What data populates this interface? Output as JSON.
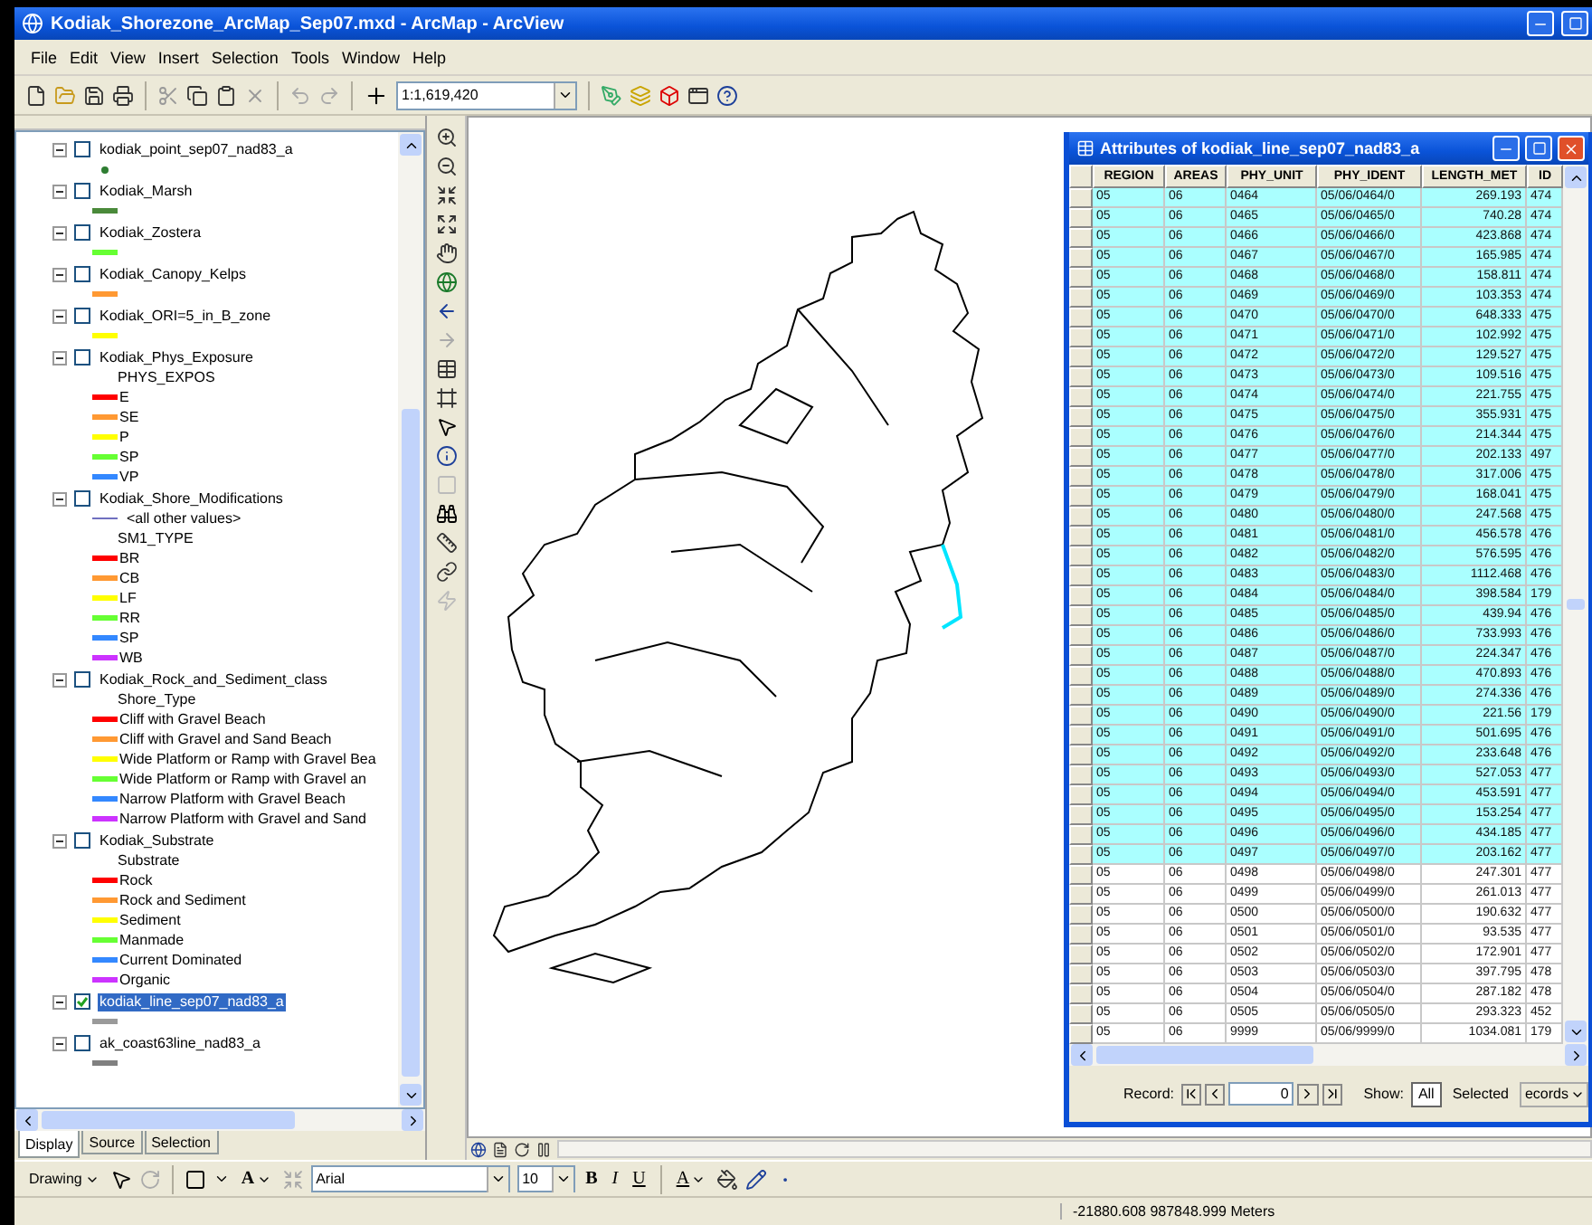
{
  "window": {
    "title": "Kodiak_Shorezone_ArcMap_Sep07.mxd - ArcMap - ArcView"
  },
  "menu": [
    {
      "label": "File"
    },
    {
      "label": "Edit"
    },
    {
      "label": "View"
    },
    {
      "label": "Insert"
    },
    {
      "label": "Selection"
    },
    {
      "label": "Tools"
    },
    {
      "label": "Window"
    },
    {
      "label": "Help"
    }
  ],
  "standard_toolbar": {
    "scale": "1:1,619,420"
  },
  "toc": {
    "layers": [
      {
        "name": "kodiak_point_sep07_nad83_a",
        "checked": false,
        "selected": false,
        "legend": [
          {
            "kind": "point",
            "color": "#2e7d32"
          }
        ]
      },
      {
        "name": "Kodiak_Marsh",
        "checked": false,
        "selected": false,
        "legend": [
          {
            "kind": "line",
            "color": "#4a8a3a"
          }
        ]
      },
      {
        "name": "Kodiak_Zostera",
        "checked": false,
        "selected": false,
        "legend": [
          {
            "kind": "line",
            "color": "#66ff33"
          }
        ]
      },
      {
        "name": "Kodiak_Canopy_Kelps",
        "checked": false,
        "selected": false,
        "legend": [
          {
            "kind": "line",
            "color": "#ff9933"
          }
        ]
      },
      {
        "name": "Kodiak_ORI=5_in_B_zone",
        "checked": false,
        "selected": false,
        "legend": [
          {
            "kind": "line",
            "color": "#ffff00"
          }
        ]
      },
      {
        "name": "Kodiak_Phys_Exposure",
        "checked": false,
        "selected": false,
        "legend": [
          {
            "kind": "heading",
            "label": "PHYS_EXPOS"
          },
          {
            "kind": "line",
            "color": "#ff0000",
            "label": "E"
          },
          {
            "kind": "line",
            "color": "#ff9933",
            "label": "SE"
          },
          {
            "kind": "line",
            "color": "#ffff00",
            "label": "P"
          },
          {
            "kind": "line",
            "color": "#66ff33",
            "label": "SP"
          },
          {
            "kind": "line",
            "color": "#3388ff",
            "label": "VP"
          }
        ]
      },
      {
        "name": "Kodiak_Shore_Modifications",
        "checked": false,
        "selected": false,
        "legend": [
          {
            "kind": "thin",
            "color": "#7070c0",
            "label": "<all other values>"
          },
          {
            "kind": "heading",
            "label": "SM1_TYPE"
          },
          {
            "kind": "line",
            "color": "#ff0000",
            "label": "BR"
          },
          {
            "kind": "line",
            "color": "#ff9933",
            "label": "CB"
          },
          {
            "kind": "line",
            "color": "#ffff00",
            "label": "LF"
          },
          {
            "kind": "line",
            "color": "#66ff33",
            "label": "RR"
          },
          {
            "kind": "line",
            "color": "#3388ff",
            "label": "SP"
          },
          {
            "kind": "line",
            "color": "#cc33ff",
            "label": "WB"
          }
        ]
      },
      {
        "name": "Kodiak_Rock_and_Sediment_class",
        "checked": false,
        "selected": false,
        "legend": [
          {
            "kind": "heading",
            "label": "Shore_Type"
          },
          {
            "kind": "line",
            "color": "#ff0000",
            "label": "Cliff with Gravel Beach"
          },
          {
            "kind": "line",
            "color": "#ff9933",
            "label": "Cliff with Gravel and Sand Beach"
          },
          {
            "kind": "line",
            "color": "#ffff00",
            "label": "Wide Platform or Ramp with Gravel Bea"
          },
          {
            "kind": "line",
            "color": "#66ff33",
            "label": "Wide Platform or Ramp with Gravel an"
          },
          {
            "kind": "line",
            "color": "#3388ff",
            "label": "Narrow Platform with Gravel Beach"
          },
          {
            "kind": "line",
            "color": "#cc33ff",
            "label": "Narrow Platform with Gravel and Sand"
          }
        ]
      },
      {
        "name": "Kodiak_Substrate",
        "checked": false,
        "selected": false,
        "legend": [
          {
            "kind": "heading",
            "label": "Substrate"
          },
          {
            "kind": "line",
            "color": "#ff0000",
            "label": "Rock"
          },
          {
            "kind": "line",
            "color": "#ff9933",
            "label": "Rock and Sediment"
          },
          {
            "kind": "line",
            "color": "#ffff00",
            "label": "Sediment"
          },
          {
            "kind": "line",
            "color": "#66ff33",
            "label": "Manmade"
          },
          {
            "kind": "line",
            "color": "#3388ff",
            "label": "Current Dominated"
          },
          {
            "kind": "line",
            "color": "#cc33ff",
            "label": "Organic"
          }
        ]
      },
      {
        "name": "kodiak_line_sep07_nad83_a",
        "checked": true,
        "selected": true,
        "legend": [
          {
            "kind": "line",
            "color": "#9a9a9a"
          }
        ]
      },
      {
        "name": "ak_coast63line_nad83_a",
        "checked": false,
        "selected": false,
        "legend": [
          {
            "kind": "line",
            "color": "#808080"
          }
        ]
      }
    ],
    "tabs": [
      {
        "label": "Display",
        "selected": true
      },
      {
        "label": "Source",
        "selected": false
      },
      {
        "label": "Selection",
        "selected": false
      }
    ]
  },
  "attribute_table": {
    "title": "Attributes of kodiak_line_sep07_nad83_a",
    "columns": [
      {
        "label": "REGION"
      },
      {
        "label": "AREAS"
      },
      {
        "label": "PHY_UNIT"
      },
      {
        "label": "PHY_IDENT"
      },
      {
        "label": "LENGTH_MET"
      },
      {
        "label": "ID"
      }
    ],
    "rows": [
      {
        "selected": true,
        "cells": [
          "05",
          "06",
          "0464",
          "05/06/0464/0",
          "269.193",
          "474"
        ]
      },
      {
        "selected": true,
        "cells": [
          "05",
          "06",
          "0465",
          "05/06/0465/0",
          "740.28",
          "474"
        ]
      },
      {
        "selected": true,
        "cells": [
          "05",
          "06",
          "0466",
          "05/06/0466/0",
          "423.868",
          "474"
        ]
      },
      {
        "selected": true,
        "cells": [
          "05",
          "06",
          "0467",
          "05/06/0467/0",
          "165.985",
          "474"
        ]
      },
      {
        "selected": true,
        "cells": [
          "05",
          "06",
          "0468",
          "05/06/0468/0",
          "158.811",
          "474"
        ]
      },
      {
        "selected": true,
        "cells": [
          "05",
          "06",
          "0469",
          "05/06/0469/0",
          "103.353",
          "474"
        ]
      },
      {
        "selected": true,
        "cells": [
          "05",
          "06",
          "0470",
          "05/06/0470/0",
          "648.333",
          "475"
        ]
      },
      {
        "selected": true,
        "cells": [
          "05",
          "06",
          "0471",
          "05/06/0471/0",
          "102.992",
          "475"
        ]
      },
      {
        "selected": true,
        "cells": [
          "05",
          "06",
          "0472",
          "05/06/0472/0",
          "129.527",
          "475"
        ]
      },
      {
        "selected": true,
        "cells": [
          "05",
          "06",
          "0473",
          "05/06/0473/0",
          "109.516",
          "475"
        ]
      },
      {
        "selected": true,
        "cells": [
          "05",
          "06",
          "0474",
          "05/06/0474/0",
          "221.755",
          "475"
        ]
      },
      {
        "selected": true,
        "cells": [
          "05",
          "06",
          "0475",
          "05/06/0475/0",
          "355.931",
          "475"
        ]
      },
      {
        "selected": true,
        "cells": [
          "05",
          "06",
          "0476",
          "05/06/0476/0",
          "214.344",
          "475"
        ]
      },
      {
        "selected": true,
        "cells": [
          "05",
          "06",
          "0477",
          "05/06/0477/0",
          "202.133",
          "497"
        ]
      },
      {
        "selected": true,
        "cells": [
          "05",
          "06",
          "0478",
          "05/06/0478/0",
          "317.006",
          "475"
        ]
      },
      {
        "selected": true,
        "cells": [
          "05",
          "06",
          "0479",
          "05/06/0479/0",
          "168.041",
          "475"
        ]
      },
      {
        "selected": true,
        "cells": [
          "05",
          "06",
          "0480",
          "05/06/0480/0",
          "247.568",
          "475"
        ]
      },
      {
        "selected": true,
        "cells": [
          "05",
          "06",
          "0481",
          "05/06/0481/0",
          "456.578",
          "476"
        ]
      },
      {
        "selected": true,
        "cells": [
          "05",
          "06",
          "0482",
          "05/06/0482/0",
          "576.595",
          "476"
        ]
      },
      {
        "selected": true,
        "cells": [
          "05",
          "06",
          "0483",
          "05/06/0483/0",
          "1112.468",
          "476"
        ]
      },
      {
        "selected": true,
        "cells": [
          "05",
          "06",
          "0484",
          "05/06/0484/0",
          "398.584",
          "179"
        ]
      },
      {
        "selected": true,
        "cells": [
          "05",
          "06",
          "0485",
          "05/06/0485/0",
          "439.94",
          "476"
        ]
      },
      {
        "selected": true,
        "cells": [
          "05",
          "06",
          "0486",
          "05/06/0486/0",
          "733.993",
          "476"
        ]
      },
      {
        "selected": true,
        "cells": [
          "05",
          "06",
          "0487",
          "05/06/0487/0",
          "224.347",
          "476"
        ]
      },
      {
        "selected": true,
        "cells": [
          "05",
          "06",
          "0488",
          "05/06/0488/0",
          "470.893",
          "476"
        ]
      },
      {
        "selected": true,
        "cells": [
          "05",
          "06",
          "0489",
          "05/06/0489/0",
          "274.336",
          "476"
        ]
      },
      {
        "selected": true,
        "cells": [
          "05",
          "06",
          "0490",
          "05/06/0490/0",
          "221.56",
          "179"
        ]
      },
      {
        "selected": true,
        "cells": [
          "05",
          "06",
          "0491",
          "05/06/0491/0",
          "501.695",
          "476"
        ]
      },
      {
        "selected": true,
        "cells": [
          "05",
          "06",
          "0492",
          "05/06/0492/0",
          "233.648",
          "476"
        ]
      },
      {
        "selected": true,
        "cells": [
          "05",
          "06",
          "0493",
          "05/06/0493/0",
          "527.053",
          "477"
        ]
      },
      {
        "selected": true,
        "cells": [
          "05",
          "06",
          "0494",
          "05/06/0494/0",
          "453.591",
          "477"
        ]
      },
      {
        "selected": true,
        "cells": [
          "05",
          "06",
          "0495",
          "05/06/0495/0",
          "153.254",
          "477"
        ]
      },
      {
        "selected": true,
        "cells": [
          "05",
          "06",
          "0496",
          "05/06/0496/0",
          "434.185",
          "477"
        ]
      },
      {
        "selected": true,
        "cells": [
          "05",
          "06",
          "0497",
          "05/06/0497/0",
          "203.162",
          "477"
        ]
      },
      {
        "selected": false,
        "cells": [
          "05",
          "06",
          "0498",
          "05/06/0498/0",
          "247.301",
          "477"
        ]
      },
      {
        "selected": false,
        "cells": [
          "05",
          "06",
          "0499",
          "05/06/0499/0",
          "261.013",
          "477"
        ]
      },
      {
        "selected": false,
        "cells": [
          "05",
          "06",
          "0500",
          "05/06/0500/0",
          "190.632",
          "477"
        ]
      },
      {
        "selected": false,
        "cells": [
          "05",
          "06",
          "0501",
          "05/06/0501/0",
          "93.535",
          "477"
        ]
      },
      {
        "selected": false,
        "cells": [
          "05",
          "06",
          "0502",
          "05/06/0502/0",
          "172.901",
          "477"
        ]
      },
      {
        "selected": false,
        "cells": [
          "05",
          "06",
          "0503",
          "05/06/0503/0",
          "397.795",
          "478"
        ]
      },
      {
        "selected": false,
        "cells": [
          "05",
          "06",
          "0504",
          "05/06/0504/0",
          "287.182",
          "478"
        ]
      },
      {
        "selected": false,
        "cells": [
          "05",
          "06",
          "0505",
          "05/06/0505/0",
          "293.323",
          "452"
        ]
      },
      {
        "selected": false,
        "cells": [
          "05",
          "06",
          "9999",
          "05/06/9999/0",
          "1034.081",
          "179"
        ]
      }
    ],
    "record_bar": {
      "record_label": "Record:",
      "record_value": "0",
      "show_label": "Show:",
      "show_buttons": [
        {
          "label": "All",
          "selected": true
        },
        {
          "label": "Selected",
          "selected": false
        }
      ],
      "records_menu": "ecords"
    }
  },
  "drawing_toolbar": {
    "label": "Drawing",
    "text_tool": "A",
    "font": "Arial",
    "size": "10",
    "bold": "B",
    "italic": "I",
    "underline": "U",
    "font_color": "A"
  },
  "status_bar": {
    "coordinates": "-21880.608  987848.999 Meters"
  }
}
